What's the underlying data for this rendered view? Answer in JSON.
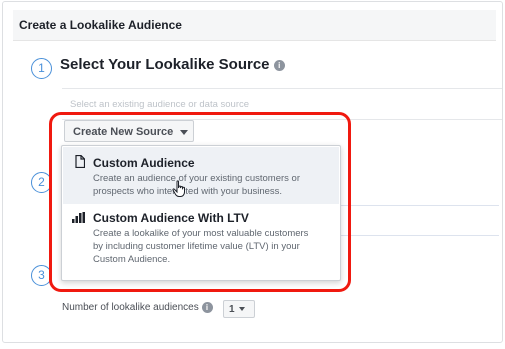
{
  "header": {
    "title": "Create a Lookalike Audience"
  },
  "steps": {
    "one": "1",
    "two": "2",
    "three": "3"
  },
  "source_section": {
    "title": "Select Your Lookalike Source",
    "info_icon": "i",
    "input_placeholder": "Select an existing audience or data source",
    "create_button_label": "Create New Source"
  },
  "dropdown": {
    "options": [
      {
        "icon": "document-icon",
        "title": "Custom Audience",
        "description_line1": "Create an audience of your existing customers or",
        "description_line2": "prospects who interacted with your business."
      },
      {
        "icon": "bar-chart-icon",
        "title": "Custom Audience With LTV",
        "description_line1": "Create a lookalike of your most valuable customers",
        "description_line2": "by including customer lifetime value (LTV) in your",
        "description_line3": "Custom Audience."
      }
    ]
  },
  "footer": {
    "count_label": "Number of lookalike audiences",
    "info_icon": "i",
    "count_value": "1"
  },
  "colors": {
    "accent_blue": "#4a90d9",
    "highlight_red": "#f0190f",
    "hover_bg": "#eef1f5"
  }
}
